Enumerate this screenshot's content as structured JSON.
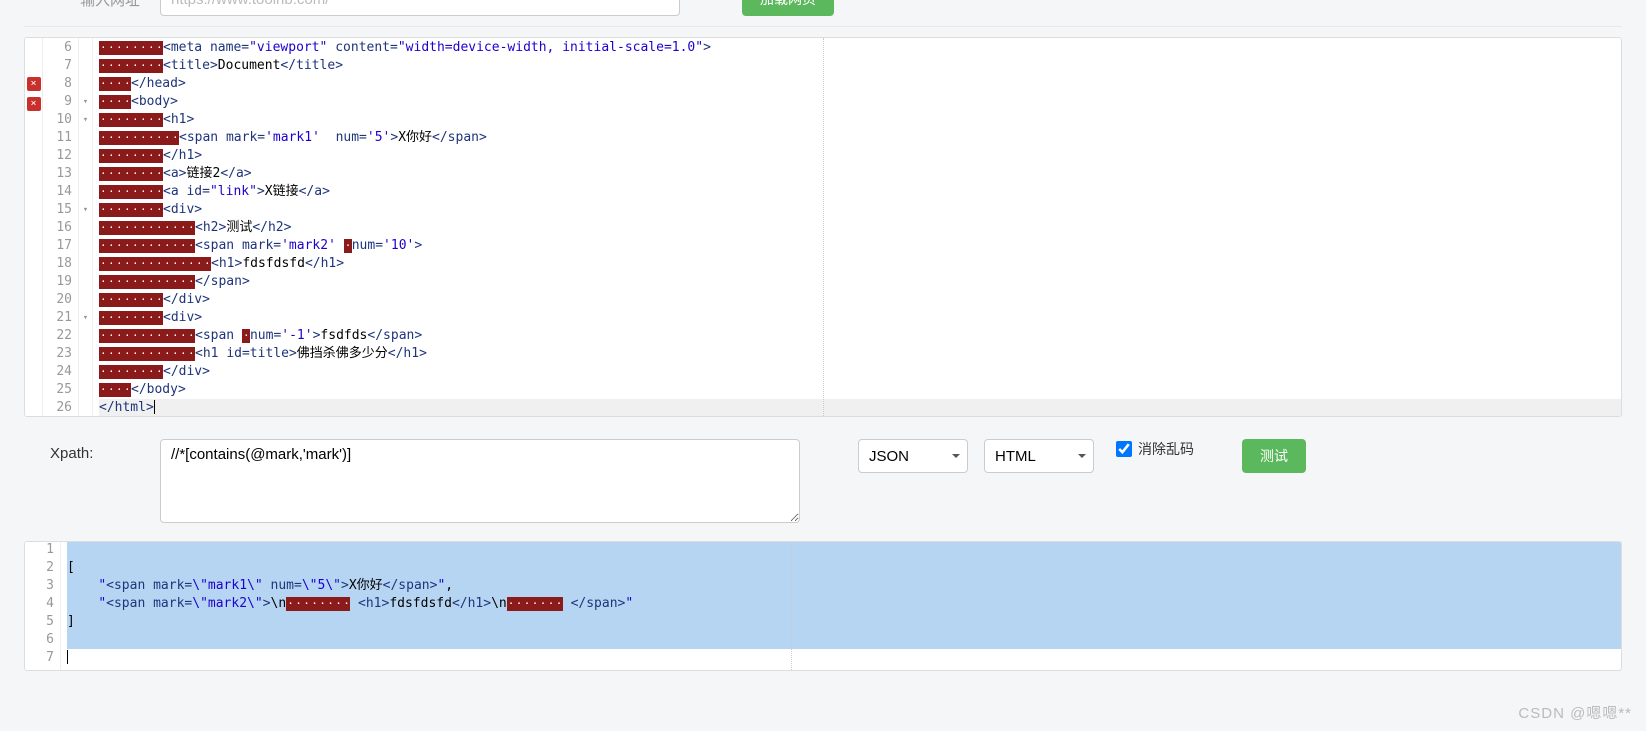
{
  "top": {
    "url_label": "输入网址",
    "url_placeholder": "https://www.toolnb.com/",
    "load_btn": "加载网页"
  },
  "editor": {
    "err_lines": [
      8,
      9
    ],
    "fold_open_lines": [
      9,
      10,
      15,
      21
    ],
    "first_line": 6,
    "lines": [
      {
        "n": 6,
        "indent": 2,
        "spaces": 0,
        "parts": [
          {
            "k": "tag",
            "v": "<meta "
          },
          {
            "k": "attr",
            "v": "name="
          },
          {
            "k": "str",
            "v": "\"viewport\""
          },
          {
            "k": "tag",
            "v": " "
          },
          {
            "k": "attr",
            "v": "content="
          },
          {
            "k": "str",
            "v": "\"width=device-width, initial-scale=1.0\""
          },
          {
            "k": "tag",
            "v": ">"
          }
        ]
      },
      {
        "n": 7,
        "indent": 2,
        "spaces": 0,
        "parts": [
          {
            "k": "tag",
            "v": "<title>"
          },
          {
            "k": "txt",
            "v": "Document"
          },
          {
            "k": "tag",
            "v": "</title>"
          }
        ]
      },
      {
        "n": 8,
        "indent": 1,
        "spaces": 0,
        "parts": [
          {
            "k": "tag",
            "v": "</head>"
          }
        ]
      },
      {
        "n": 9,
        "indent": 1,
        "spaces": 0,
        "parts": [
          {
            "k": "tag",
            "v": "<body>"
          }
        ]
      },
      {
        "n": 10,
        "indent": 2,
        "spaces": 0,
        "parts": [
          {
            "k": "tag",
            "v": "<h1>"
          }
        ]
      },
      {
        "n": 11,
        "indent": 2,
        "spaces": 2,
        "parts": [
          {
            "k": "tag",
            "v": "<span "
          },
          {
            "k": "attr",
            "v": "mark="
          },
          {
            "k": "str",
            "v": "'mark1'"
          },
          {
            "k": "tag",
            "v": "  "
          },
          {
            "k": "attr",
            "v": "num="
          },
          {
            "k": "str",
            "v": "'5'"
          },
          {
            "k": "tag",
            "v": ">"
          },
          {
            "k": "txt",
            "v": "X你好"
          },
          {
            "k": "tag",
            "v": "</span>"
          }
        ]
      },
      {
        "n": 12,
        "indent": 2,
        "spaces": 0,
        "parts": [
          {
            "k": "tag",
            "v": "</h1>"
          }
        ]
      },
      {
        "n": 13,
        "indent": 2,
        "spaces": 0,
        "parts": [
          {
            "k": "tag",
            "v": "<a>"
          },
          {
            "k": "txt",
            "v": "链接2"
          },
          {
            "k": "tag",
            "v": "</a>"
          }
        ]
      },
      {
        "n": 14,
        "indent": 2,
        "spaces": 0,
        "parts": [
          {
            "k": "tag",
            "v": "<a "
          },
          {
            "k": "attr",
            "v": "id="
          },
          {
            "k": "str",
            "v": "\"link\""
          },
          {
            "k": "tag",
            "v": ">"
          },
          {
            "k": "txt",
            "v": "X链接"
          },
          {
            "k": "tag",
            "v": "</a>"
          }
        ]
      },
      {
        "n": 15,
        "indent": 2,
        "spaces": 0,
        "parts": [
          {
            "k": "tag",
            "v": "<div>"
          }
        ]
      },
      {
        "n": 16,
        "indent": 3,
        "spaces": 0,
        "parts": [
          {
            "k": "tag",
            "v": "<h2>"
          },
          {
            "k": "txt",
            "v": "测试"
          },
          {
            "k": "tag",
            "v": "</h2>"
          }
        ]
      },
      {
        "n": 17,
        "indent": 3,
        "spaces": 0,
        "parts": [
          {
            "k": "tag",
            "v": "<span "
          },
          {
            "k": "attr",
            "v": "mark="
          },
          {
            "k": "str",
            "v": "'mark2'"
          },
          {
            "k": "tag",
            "v": " "
          },
          {
            "k": "ws",
            "v": 1
          },
          {
            "k": "attr",
            "v": "num="
          },
          {
            "k": "str",
            "v": "'10'"
          },
          {
            "k": "tag",
            "v": ">"
          }
        ]
      },
      {
        "n": 18,
        "indent": 3,
        "spaces": 2,
        "parts": [
          {
            "k": "tag",
            "v": "<h1>"
          },
          {
            "k": "txt",
            "v": "fdsfdsfd"
          },
          {
            "k": "tag",
            "v": "</h1>"
          }
        ]
      },
      {
        "n": 19,
        "indent": 3,
        "spaces": 0,
        "parts": [
          {
            "k": "tag",
            "v": "</span>"
          }
        ]
      },
      {
        "n": 20,
        "indent": 2,
        "spaces": 0,
        "parts": [
          {
            "k": "tag",
            "v": "</div>"
          }
        ]
      },
      {
        "n": 21,
        "indent": 2,
        "spaces": 0,
        "parts": [
          {
            "k": "tag",
            "v": "<div>"
          }
        ]
      },
      {
        "n": 22,
        "indent": 3,
        "spaces": 0,
        "parts": [
          {
            "k": "tag",
            "v": "<span "
          },
          {
            "k": "ws",
            "v": 1
          },
          {
            "k": "attr",
            "v": "num="
          },
          {
            "k": "str",
            "v": "'-1'"
          },
          {
            "k": "tag",
            "v": ">"
          },
          {
            "k": "txt",
            "v": "fsdfds"
          },
          {
            "k": "tag",
            "v": "</span>"
          }
        ]
      },
      {
        "n": 23,
        "indent": 3,
        "spaces": 0,
        "parts": [
          {
            "k": "tag",
            "v": "<h1 "
          },
          {
            "k": "attr",
            "v": "id="
          },
          {
            "k": "attr",
            "v": "title"
          },
          {
            "k": "tag",
            "v": ">"
          },
          {
            "k": "txt",
            "v": "佛挡杀佛多少分"
          },
          {
            "k": "tag",
            "v": "</h1>"
          }
        ]
      },
      {
        "n": 24,
        "indent": 2,
        "spaces": 0,
        "parts": [
          {
            "k": "tag",
            "v": "</div>"
          }
        ]
      },
      {
        "n": 25,
        "indent": 1,
        "spaces": 0,
        "parts": [
          {
            "k": "tag",
            "v": "</body>"
          }
        ]
      },
      {
        "n": 26,
        "indent": 0,
        "spaces": 0,
        "active": true,
        "cursor": true,
        "parts": [
          {
            "k": "tag",
            "v": "</html>"
          }
        ]
      }
    ]
  },
  "xpath": {
    "label": "Xpath:",
    "value": "//*[contains(@mark,'mark')]",
    "format_sel": "JSON",
    "output_sel": "HTML",
    "clean_label": "消除乱码",
    "clean_checked": true,
    "test_btn": "测试"
  },
  "result": {
    "lines": [
      {
        "n": 1,
        "sel": true,
        "parts": []
      },
      {
        "n": 2,
        "sel": true,
        "parts": [
          {
            "k": "txt",
            "v": "["
          }
        ]
      },
      {
        "n": 3,
        "sel": true,
        "parts": [
          {
            "k": "txt",
            "v": "    "
          },
          {
            "k": "str",
            "v": "\""
          },
          {
            "k": "tag",
            "v": "<span "
          },
          {
            "k": "attr",
            "v": "mark="
          },
          {
            "k": "str",
            "v": "\\\"mark1\\\""
          },
          {
            "k": "tag",
            "v": " "
          },
          {
            "k": "attr",
            "v": "num="
          },
          {
            "k": "str",
            "v": "\\\"5\\\""
          },
          {
            "k": "tag",
            "v": ">"
          },
          {
            "k": "txt",
            "v": "X你好"
          },
          {
            "k": "tag",
            "v": "</span>"
          },
          {
            "k": "str",
            "v": "\""
          },
          {
            "k": "txt",
            "v": ","
          }
        ]
      },
      {
        "n": 4,
        "sel": true,
        "parts": [
          {
            "k": "txt",
            "v": "    "
          },
          {
            "k": "str",
            "v": "\""
          },
          {
            "k": "tag",
            "v": "<span "
          },
          {
            "k": "attr",
            "v": "mark="
          },
          {
            "k": "str",
            "v": "\\\"mark2\\\""
          },
          {
            "k": "tag",
            "v": ">"
          },
          {
            "k": "txt",
            "v": "\\n"
          },
          {
            "k": "ws",
            "v": 8
          },
          {
            "k": "tag",
            "v": " <h1>"
          },
          {
            "k": "txt",
            "v": "fdsfdsfd"
          },
          {
            "k": "tag",
            "v": "</h1>"
          },
          {
            "k": "txt",
            "v": "\\n"
          },
          {
            "k": "ws",
            "v": 7
          },
          {
            "k": "tag",
            "v": " </span>"
          },
          {
            "k": "str",
            "v": "\""
          }
        ]
      },
      {
        "n": 5,
        "sel": true,
        "parts": [
          {
            "k": "txt",
            "v": "]"
          }
        ]
      },
      {
        "n": 6,
        "sel": true,
        "parts": []
      },
      {
        "n": 7,
        "sel": false,
        "cursor": true,
        "parts": []
      }
    ]
  },
  "watermark": "CSDN @嗯嗯**"
}
